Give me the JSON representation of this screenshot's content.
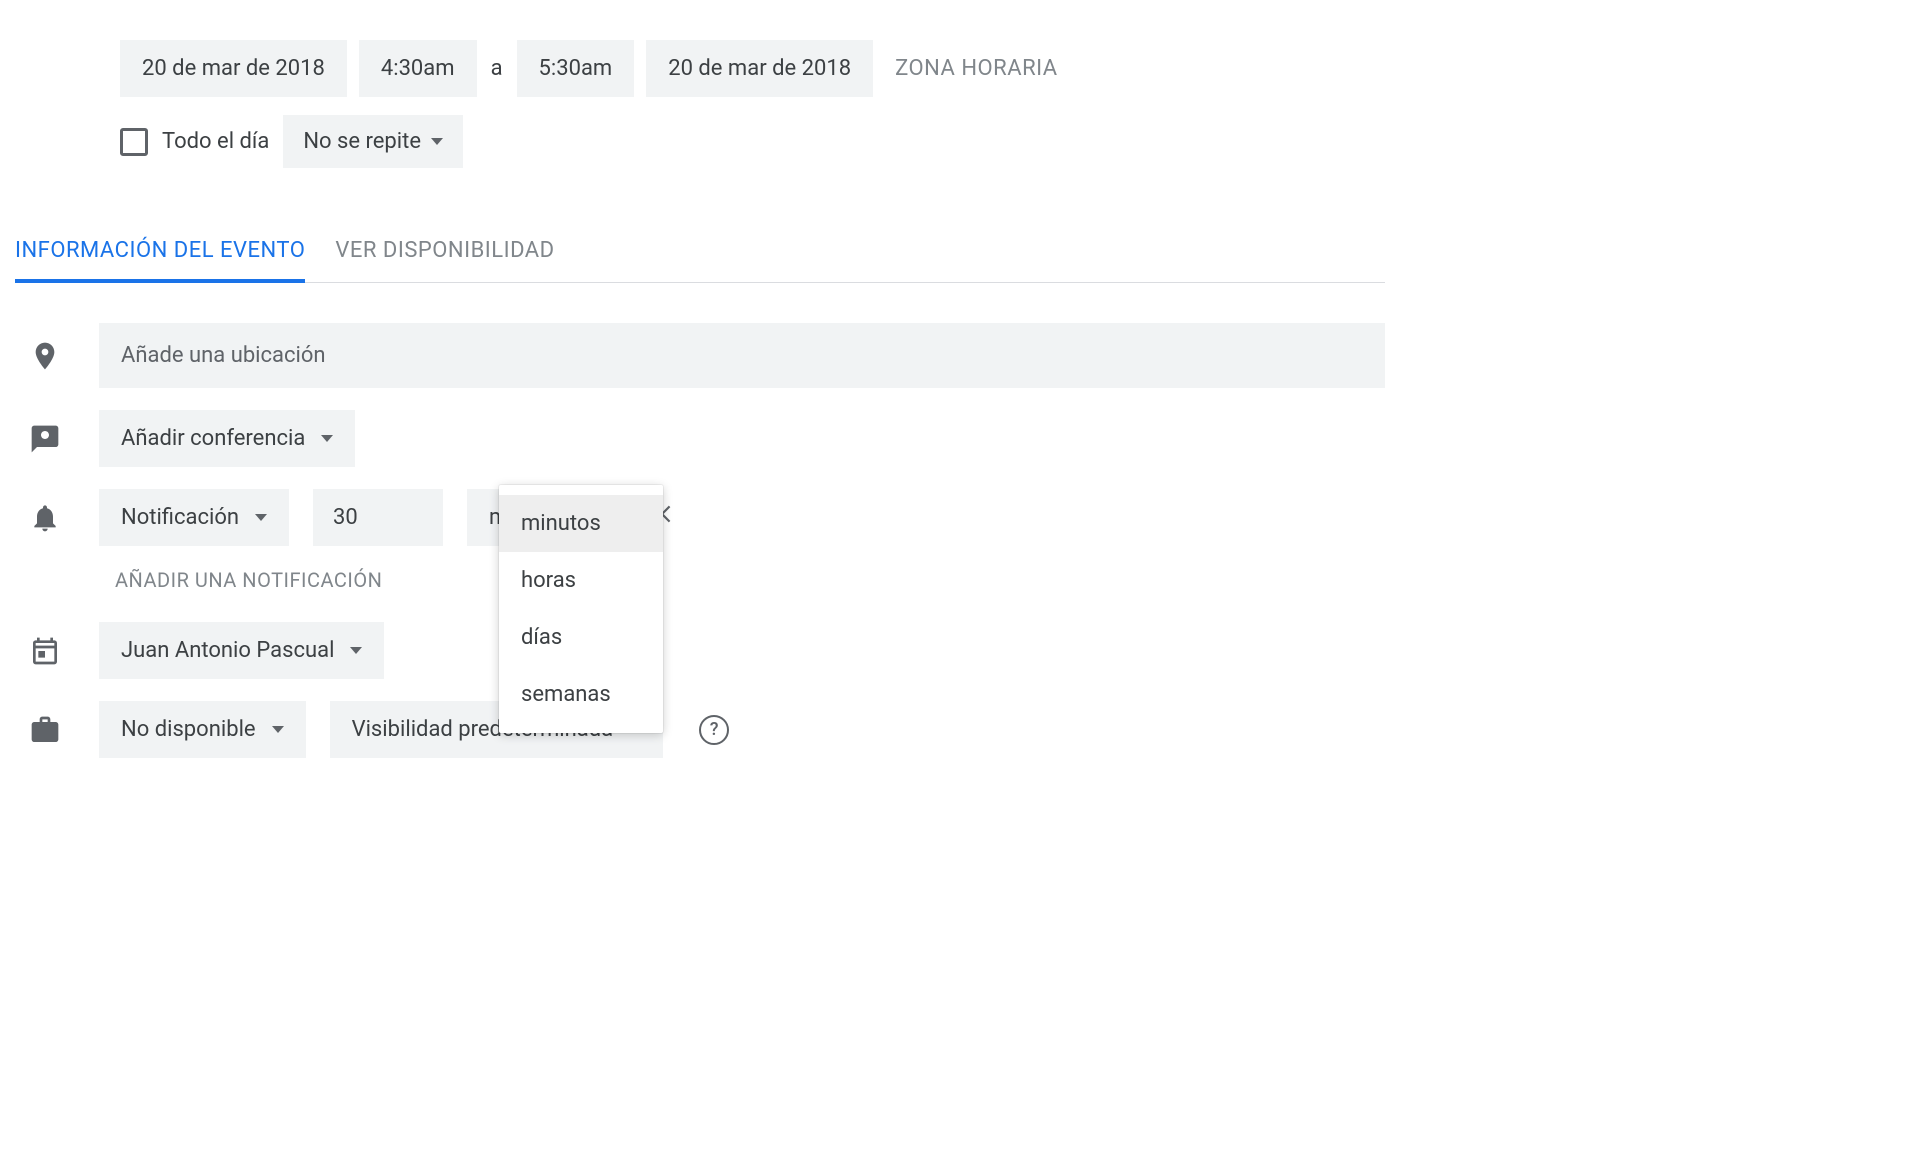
{
  "dateTime": {
    "startDate": "20 de mar de 2018",
    "startTime": "4:30am",
    "toLabel": "a",
    "endTime": "5:30am",
    "endDate": "20 de mar de 2018",
    "timezoneLabel": "ZONA HORARIA"
  },
  "allDay": {
    "label": "Todo el día",
    "repeatLabel": "No se repite"
  },
  "tabs": {
    "eventInfo": "INFORMACIÓN DEL EVENTO",
    "availability": "VER DISPONIBILIDAD"
  },
  "location": {
    "placeholder": "Añade una ubicación"
  },
  "conference": {
    "label": "Añadir conferencia"
  },
  "notification": {
    "typeLabel": "Notificación",
    "value": "30",
    "unitSelected": "minutos",
    "unitOptions": [
      "minutos",
      "horas",
      "días",
      "semanas"
    ],
    "addLabel": "AÑADIR UNA NOTIFICACIÓN"
  },
  "calendar": {
    "ownerLabel": "Juan Antonio Pascual"
  },
  "busy": {
    "availabilityLabel": "No disponible",
    "visibilityLabel": "Visibilidad predeterminada"
  },
  "helpChar": "?"
}
